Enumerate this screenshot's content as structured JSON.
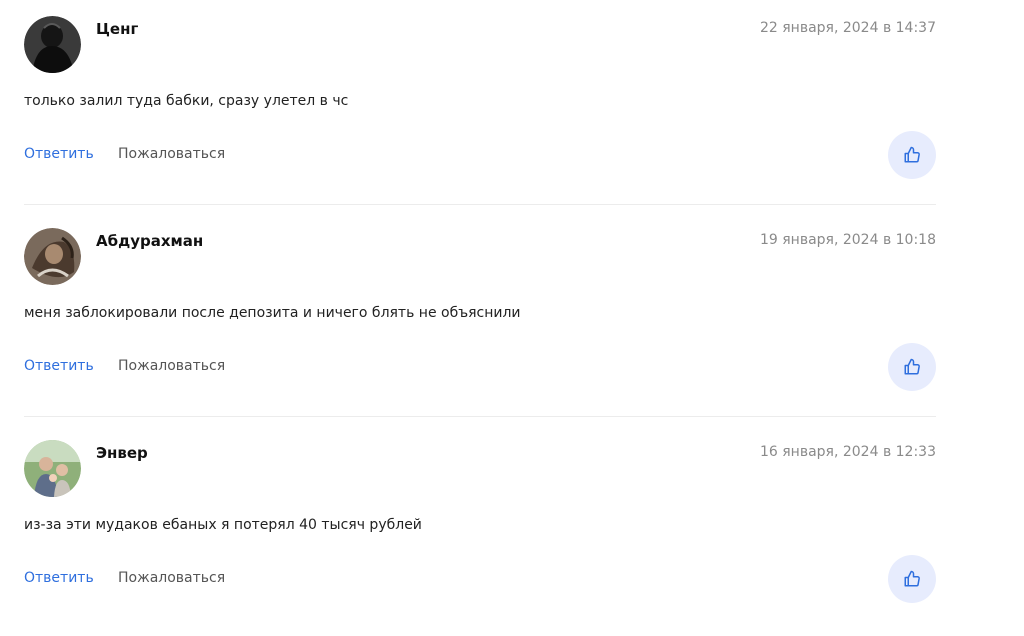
{
  "comments": [
    {
      "author": "Ценг",
      "date": "22 января, 2024 в 14:37",
      "text": "только залил туда бабки, сразу улетел в чс",
      "reply_label": "Ответить",
      "report_label": "Пожаловаться",
      "avatar_icon": "dark-figure-photo",
      "like_icon": "thumbs-up-icon"
    },
    {
      "author": "Абдурахман",
      "date": "19 января, 2024 в 10:18",
      "text": "меня заблокировали после депозита и ничего блять не объяснили",
      "reply_label": "Ответить",
      "report_label": "Пожаловаться",
      "avatar_icon": "warrior-art-photo",
      "like_icon": "thumbs-up-icon"
    },
    {
      "author": "Энвер",
      "date": "16 января, 2024 в 12:33",
      "text": "из-за эти мудаков ебаных я потерял 40 тысяч рублей",
      "reply_label": "Ответить",
      "report_label": "Пожаловаться",
      "avatar_icon": "family-outdoor-photo",
      "like_icon": "thumbs-up-icon"
    }
  ],
  "colors": {
    "accent": "#2f6fde",
    "like_bg": "#e7ecfd",
    "date": "#8a8a8a"
  }
}
